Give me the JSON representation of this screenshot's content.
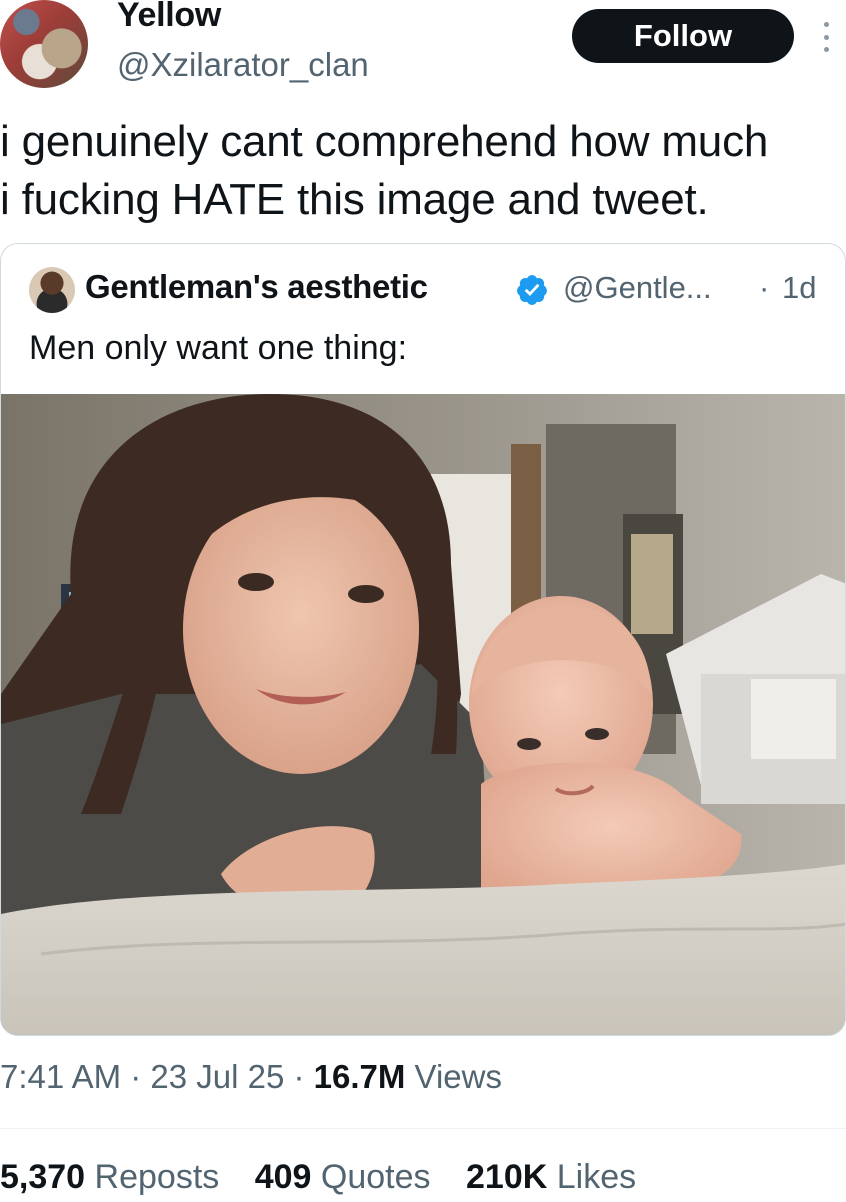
{
  "author": {
    "name": "Yellow",
    "handle": "@Xzilarator_clan",
    "follow_label": "Follow"
  },
  "tweet": {
    "text_line1": "i genuinely cant comprehend how much",
    "text_line2": "i fucking HATE this image and tweet."
  },
  "quoted": {
    "name": "Gentleman's aesthetic",
    "handle": "@Gentle...",
    "separator": "·",
    "time": "1d",
    "text": "Men only want one thing:",
    "verified_color": "#1d9bf0"
  },
  "meta": {
    "time": "7:41 AM",
    "dot1": " · ",
    "date": "23 Jul 25",
    "dot2": " · ",
    "views_count": "16.7M",
    "views_label": " Views"
  },
  "stats": [
    {
      "count": "5,370",
      "label": "Reposts"
    },
    {
      "count": "409",
      "label": "Quotes"
    },
    {
      "count": "210K",
      "label": "Likes"
    }
  ],
  "icons": [
    "more-icon",
    "verified-icon"
  ]
}
